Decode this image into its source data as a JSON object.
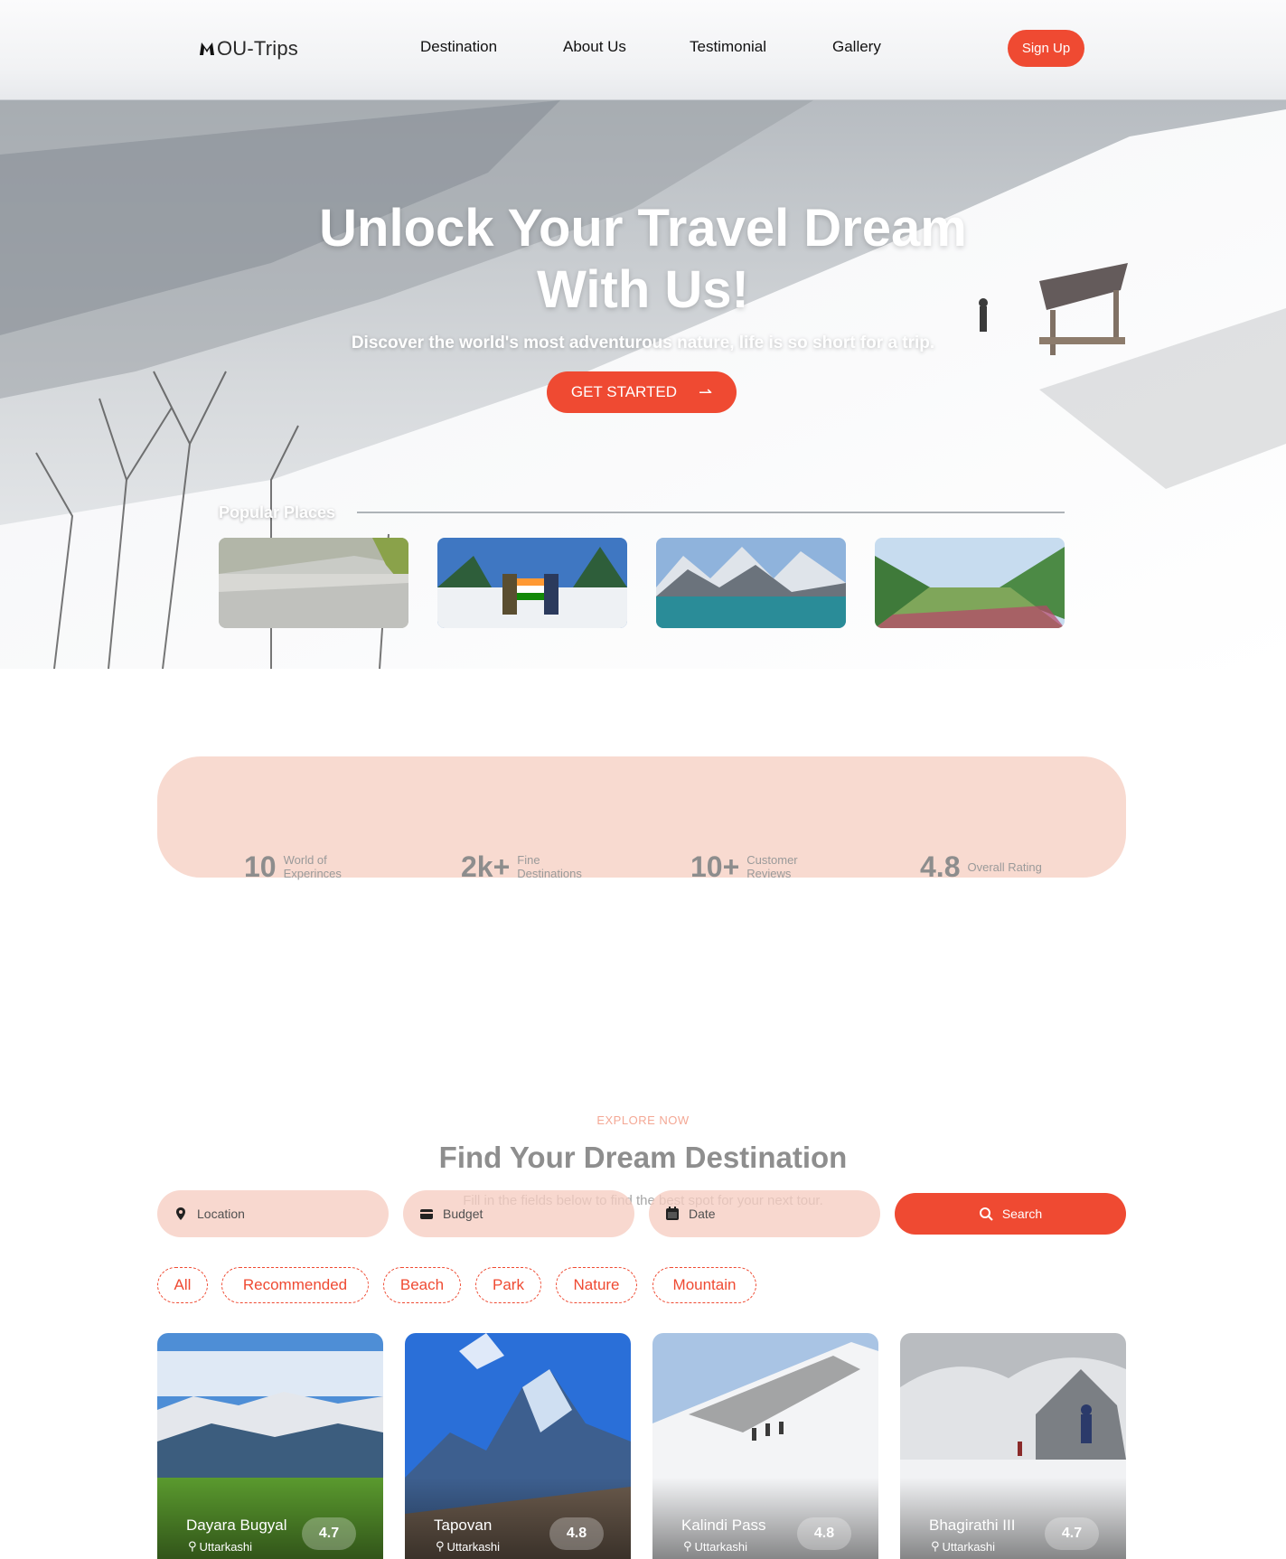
{
  "header": {
    "logo_text": "OU-Trips",
    "nav": [
      "Destination",
      "About Us",
      "Testimonial",
      "Gallery"
    ],
    "signup_label": "Sign Up"
  },
  "hero": {
    "title_line1": "Unlock Your Travel Dream",
    "title_line2": "With Us!",
    "subtitle": "Discover the world's most adventurous nature, life is so short for a trip.",
    "cta_label": "GET STARTED",
    "cta_icon": "arrow-right-icon",
    "popular_title": "Popular Places"
  },
  "stats": [
    {
      "number": "10",
      "label": "World of Experinces"
    },
    {
      "number": "2k+",
      "label": "Fine Destinations"
    },
    {
      "number": "10+",
      "label": "Customer Reviews"
    },
    {
      "number": "4.8",
      "label": "Overall Rating"
    }
  ],
  "explore": {
    "eyebrow": "EXPLORE NOW",
    "title": "Find Your Dream Destination",
    "subtitle": "Fill in the fields below to find the best spot for your next tour.",
    "fields": [
      {
        "icon": "location-pin-icon",
        "placeholder": "Location"
      },
      {
        "icon": "wallet-icon",
        "placeholder": "Budget"
      },
      {
        "icon": "calendar-icon",
        "placeholder": "Date"
      }
    ],
    "search_label": "Search",
    "search_icon": "search-icon",
    "filters": [
      "All",
      "Recommended",
      "Beach",
      "Park",
      "Nature",
      "Mountain"
    ]
  },
  "destinations": [
    {
      "name": "Dayara Bugyal",
      "location": "Uttarkashi",
      "rating": "4.7"
    },
    {
      "name": "Tapovan",
      "location": "Uttarkashi",
      "rating": "4.8"
    },
    {
      "name": "Kalindi Pass",
      "location": "Uttarkashi",
      "rating": "4.8"
    },
    {
      "name": "Bhagirathi III",
      "location": "Uttarkashi",
      "rating": "4.7"
    }
  ],
  "colors": {
    "accent": "#ef4a32",
    "stats_bg": "#f8dad0",
    "field_bg": "#f6cdc1"
  }
}
